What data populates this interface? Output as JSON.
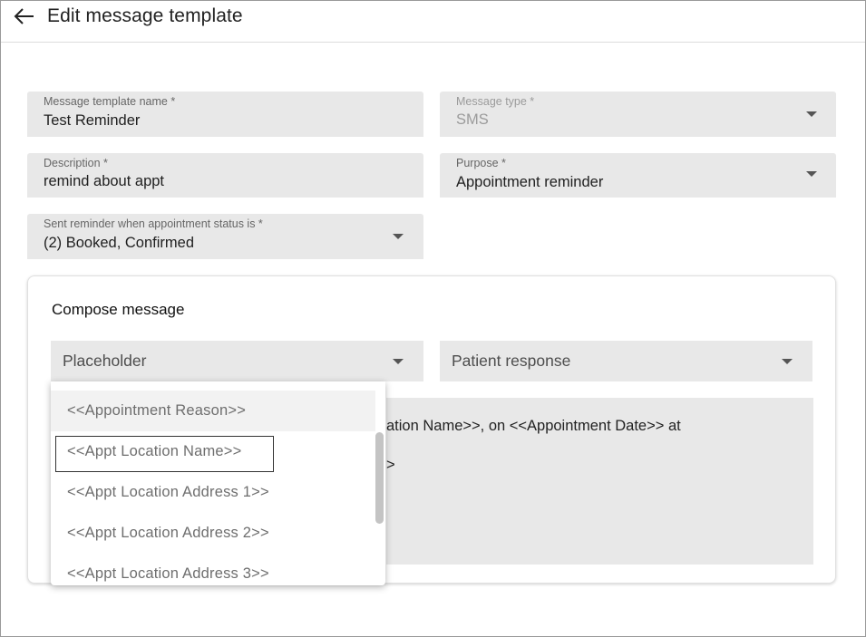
{
  "header": {
    "back_icon": "arrow-left-icon",
    "title": "Edit message template"
  },
  "form": {
    "template_name": {
      "label": "Message template name *",
      "value": "Test Reminder"
    },
    "message_type": {
      "label": "Message type *",
      "value": "SMS",
      "disabled": true
    },
    "description": {
      "label": "Description *",
      "value": "remind about appt"
    },
    "purpose": {
      "label": "Purpose *",
      "value": "Appointment reminder"
    },
    "status_filter": {
      "label": "Sent reminder when appointment status is *",
      "value": "(2) Booked, Confirmed"
    }
  },
  "compose": {
    "title": "Compose message",
    "placeholder_select": {
      "value": "Placeholder"
    },
    "patient_response_select": {
      "value": "Patient response"
    },
    "message_line1": "ation Name>>, on <<Appointment Date>> at",
    "message_line2": ">"
  },
  "placeholder_dropdown": {
    "items": [
      "<<Appointment Reason>>",
      "<<Appt Location Name>>",
      "<<Appt Location Address 1>>",
      "<<Appt Location Address 2>>",
      "<<Appt Location Address 3>>"
    ],
    "hovered_index": 0,
    "focused_index": 1
  },
  "colors": {
    "field_bg": "#e8e8e8",
    "focus_border": "#333333",
    "scroll_thumb": "#c4c4c4"
  }
}
